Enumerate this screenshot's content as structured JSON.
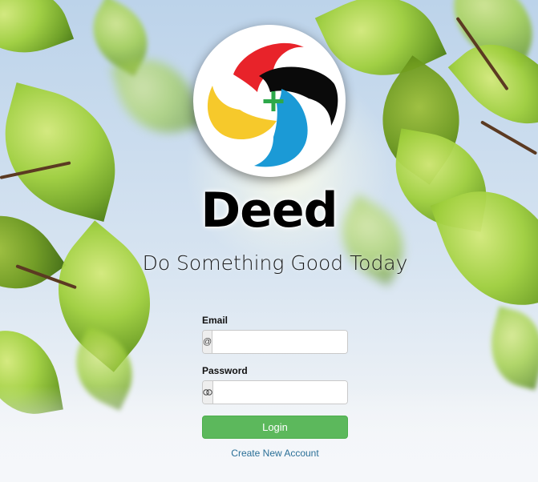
{
  "app": {
    "title": "Deed",
    "tagline": "Do Something Good Today"
  },
  "logo": {
    "icon": "deed-swirl-logo",
    "colors": {
      "red": "#e8232a",
      "black": "#0a0a0a",
      "blue": "#1b9ad6",
      "yellow": "#f6c92b",
      "plus": "#2da84a"
    }
  },
  "form": {
    "email": {
      "label": "Email",
      "addon": "@",
      "value": "",
      "placeholder": ""
    },
    "password": {
      "label": "Password",
      "addon_icon": "eye-icon",
      "value": "",
      "placeholder": ""
    },
    "login_label": "Login",
    "create_account_label": "Create New Account"
  },
  "colors": {
    "button": "#5cb85c",
    "link": "#2a6f97"
  }
}
